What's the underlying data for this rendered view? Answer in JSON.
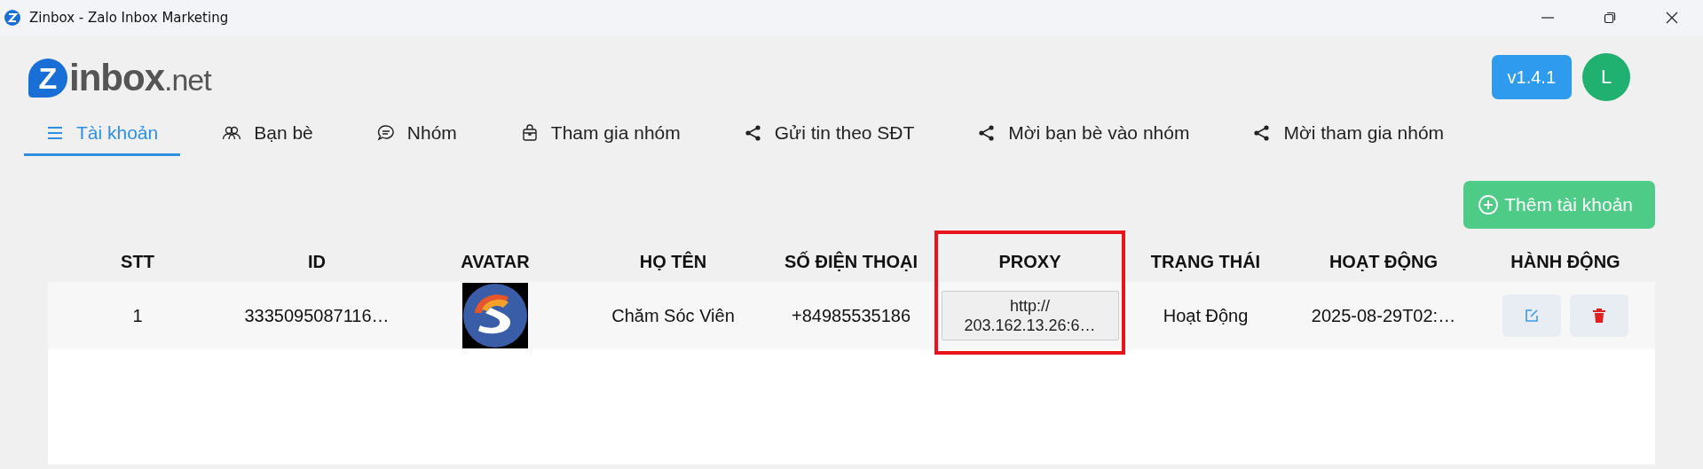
{
  "window": {
    "title": "Zinbox - Zalo Inbox Marketing"
  },
  "logo": {
    "mark": "Z",
    "text": "inbox",
    "suffix": ".net"
  },
  "version": "v1.4.1",
  "user_avatar": "L",
  "tabs": [
    {
      "label": "Tài khoản",
      "kind": "menu",
      "selected": true
    },
    {
      "label": "Bạn bè",
      "kind": "users",
      "selected": false
    },
    {
      "label": "Nhóm",
      "kind": "chat",
      "selected": false
    },
    {
      "label": "Tham gia nhóm",
      "kind": "bag",
      "selected": false
    },
    {
      "label": "Gửi tin theo SĐT",
      "kind": "share",
      "selected": false
    },
    {
      "label": "Mời bạn bè vào nhóm",
      "kind": "share",
      "selected": false
    },
    {
      "label": "Mời tham gia nhóm",
      "kind": "share",
      "selected": false
    }
  ],
  "add_button": "Thêm tài khoản",
  "table": {
    "columns": [
      {
        "label": "STT",
        "highlighted": false
      },
      {
        "label": "ID",
        "highlighted": false
      },
      {
        "label": "AVATAR",
        "highlighted": false
      },
      {
        "label": "HỌ TÊN",
        "highlighted": false
      },
      {
        "label": "SỐ ĐIỆN THOẠI",
        "highlighted": false
      },
      {
        "label": "PROXY",
        "highlighted": true
      },
      {
        "label": "TRẠNG THÁI",
        "highlighted": false
      },
      {
        "label": "HOẠT ĐỘNG",
        "highlighted": false
      },
      {
        "label": "HÀNH ĐỘNG",
        "highlighted": false
      }
    ],
    "rows": [
      {
        "stt": "1",
        "id": "3335095087116…",
        "name": "Chăm Sóc Viên",
        "phone": "+84985535186",
        "proxy": "http://\n203.162.13.26:6…",
        "status": "Hoạt Động",
        "activity": "2025-08-29T02:…"
      }
    ]
  }
}
